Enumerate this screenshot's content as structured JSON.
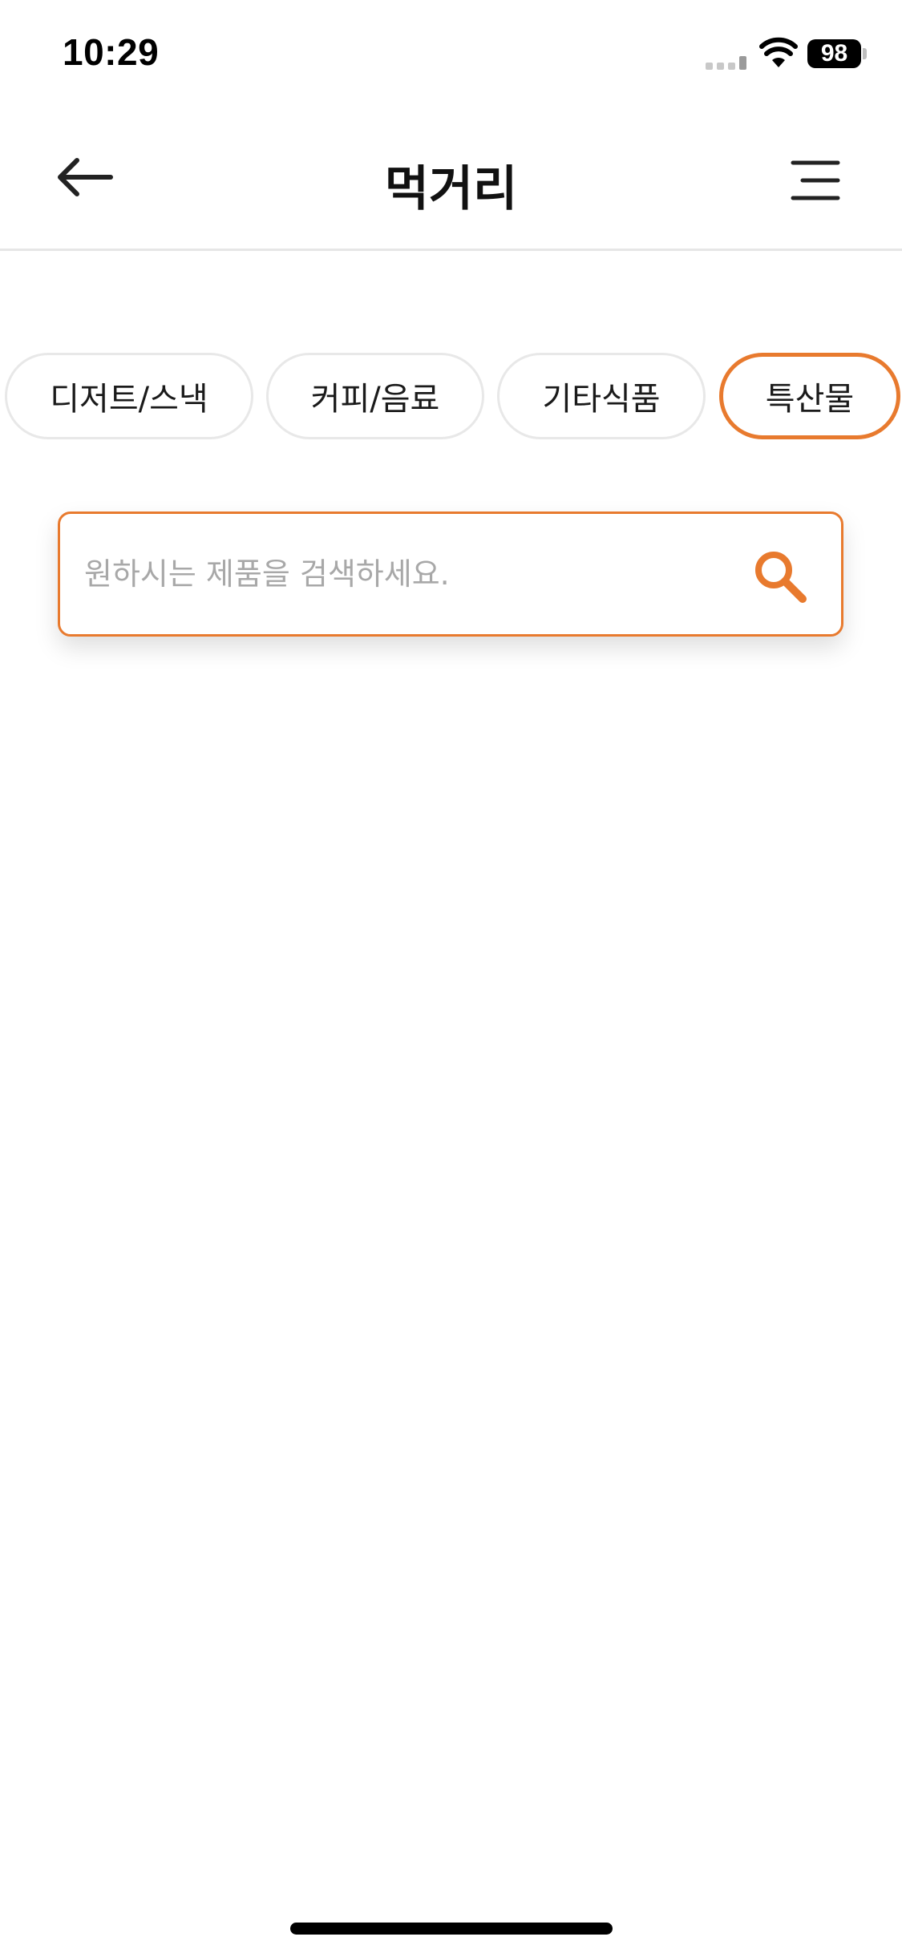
{
  "status_bar": {
    "time": "10:29",
    "battery": "98"
  },
  "header": {
    "title": "먹거리",
    "back_icon": "arrow-left-icon",
    "menu_icon": "menu-lines-icon"
  },
  "categories": [
    {
      "label": "디저트/스낵",
      "selected": false
    },
    {
      "label": "커피/음료",
      "selected": false
    },
    {
      "label": "기타식품",
      "selected": false
    },
    {
      "label": "특산물",
      "selected": true
    }
  ],
  "search": {
    "placeholder": "원하시는 제품을 검색하세요.",
    "value": "",
    "icon": "search-icon"
  },
  "colors": {
    "accent": "#e87a2e",
    "chip_border": "#e8e8e8",
    "divider": "#e6e6e6",
    "placeholder": "#a8a8a8"
  }
}
